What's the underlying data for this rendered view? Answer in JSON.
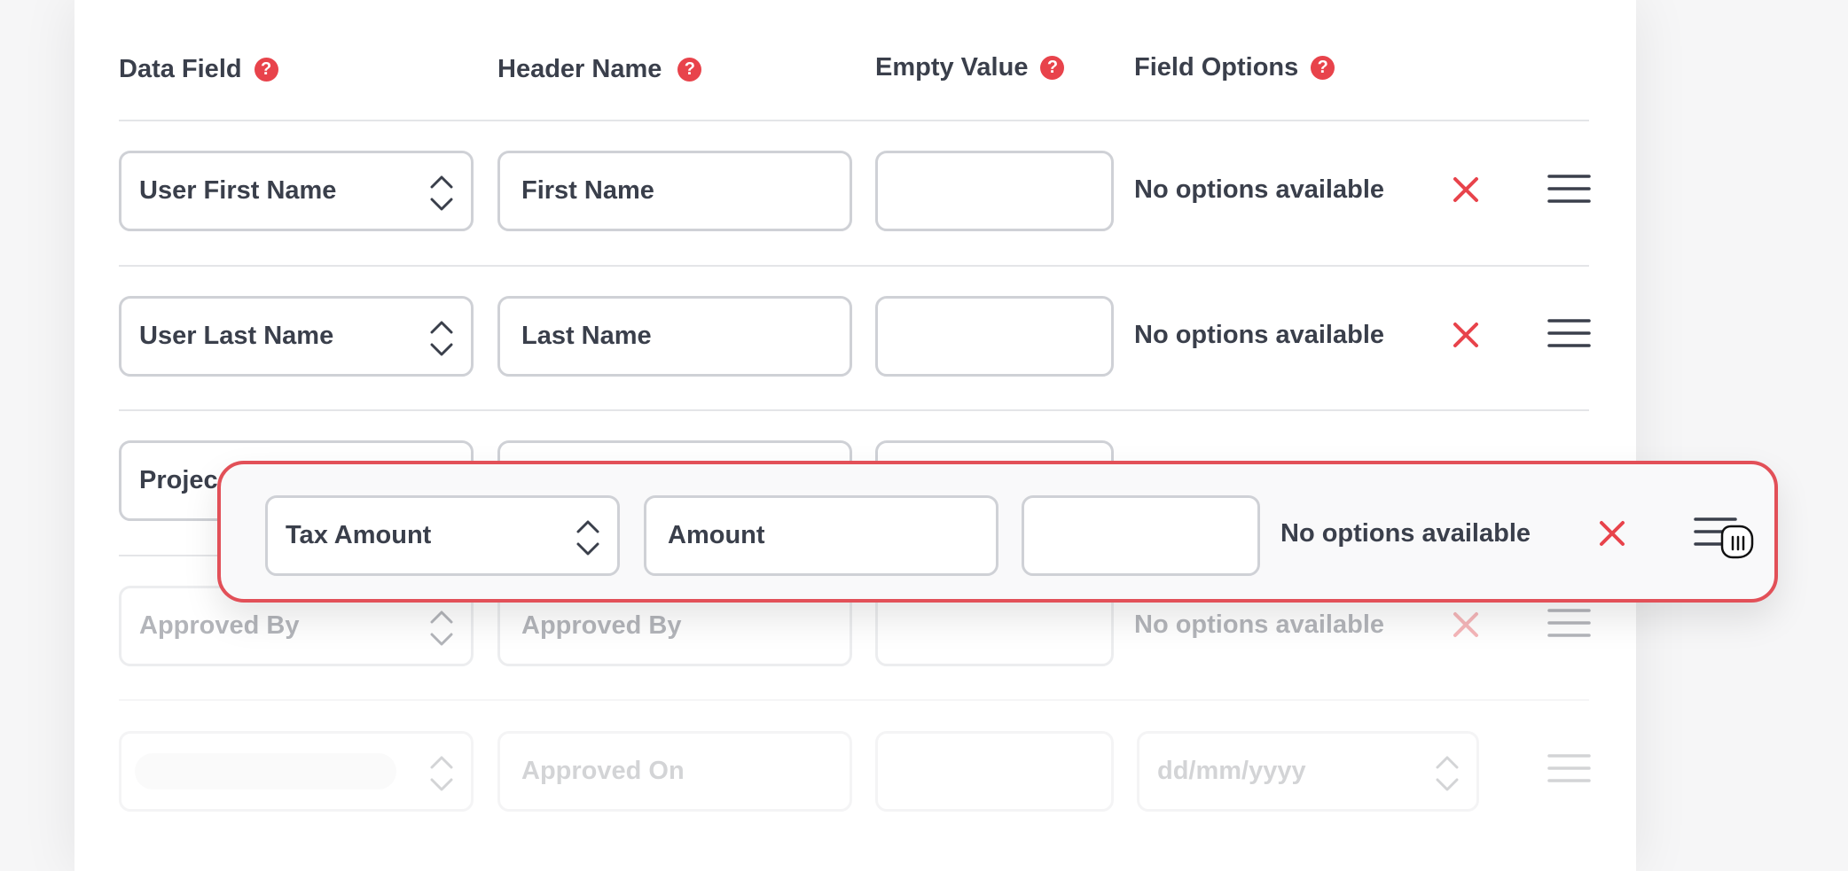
{
  "headers": {
    "data_field": "Data Field",
    "header_name": "Header Name",
    "empty_value": "Empty Value",
    "field_options": "Field Options",
    "help_glyph": "?"
  },
  "rows": [
    {
      "data_field": "User First Name",
      "header_name": "First Name",
      "empty_value": "",
      "field_options": "No options available"
    },
    {
      "data_field": "User Last Name",
      "header_name": "Last Name",
      "empty_value": "",
      "field_options": "No options available"
    },
    {
      "data_field": "Projec",
      "header_name": "",
      "empty_value": "",
      "field_options": ""
    },
    {
      "data_field": "Approved By",
      "header_name": "Approved By",
      "empty_value": "",
      "field_options": "No options available"
    },
    {
      "data_field": "",
      "header_name": "Approved On",
      "empty_value": "",
      "field_options": "dd/mm/yyyy"
    }
  ],
  "dragging_row": {
    "data_field": "Tax Amount",
    "header_name": "Amount",
    "empty_value": "",
    "field_options": "No options available"
  },
  "colors": {
    "accent": "#e8434b",
    "text": "#3a3f4b",
    "border": "#cfd1d6"
  },
  "icons": [
    "help-icon",
    "chevron-updown-icon",
    "close-icon",
    "hamburger-menu-icon",
    "grab-hand-cursor-icon"
  ]
}
